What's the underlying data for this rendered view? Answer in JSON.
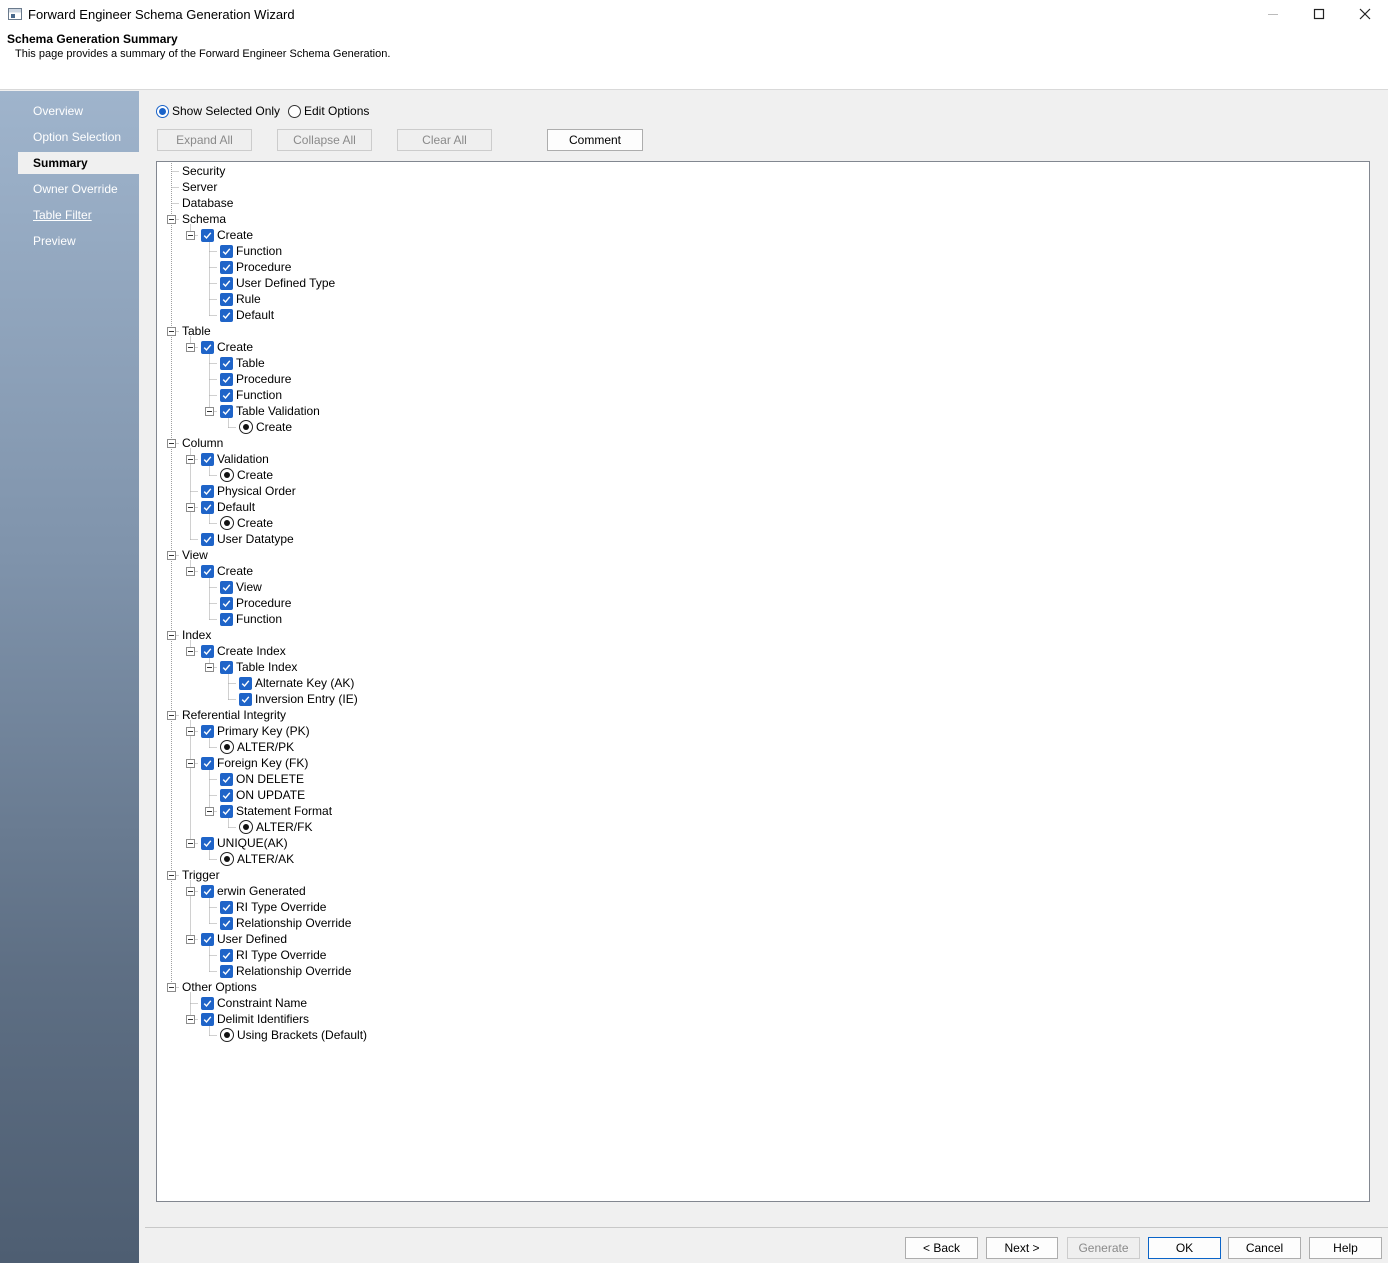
{
  "window": {
    "title": "Forward Engineer Schema Generation Wizard",
    "controls": [
      "minimize-icon",
      "maximize-icon",
      "close-icon"
    ]
  },
  "header": {
    "title": "Schema Generation Summary",
    "subtitle": "This page provides a summary of the Forward Engineer Schema Generation."
  },
  "sidebar": {
    "items": [
      {
        "label": "Overview",
        "state": "normal"
      },
      {
        "label": "Option Selection",
        "state": "normal"
      },
      {
        "label": "Summary",
        "state": "active"
      },
      {
        "label": "Owner Override",
        "state": "normal"
      },
      {
        "label": "Table Filter",
        "state": "link"
      },
      {
        "label": "Preview",
        "state": "normal"
      }
    ]
  },
  "view_mode": {
    "show_selected_only": "Show Selected Only",
    "edit_options": "Edit Options",
    "selected": "show_selected_only"
  },
  "toolbar": {
    "expand_all": "Expand All",
    "collapse_all": "Collapse All",
    "clear_all": "Clear All",
    "comment": "Comment"
  },
  "tree": [
    {
      "label": "Security",
      "level": 0,
      "control": "none"
    },
    {
      "label": "Server",
      "level": 0,
      "control": "none"
    },
    {
      "label": "Database",
      "level": 0,
      "control": "none"
    },
    {
      "label": "Schema",
      "level": 0,
      "control": "none",
      "expanded": true
    },
    {
      "label": "Create",
      "level": 1,
      "control": "checkbox",
      "expanded": true
    },
    {
      "label": "Function",
      "level": 2,
      "control": "checkbox"
    },
    {
      "label": "Procedure",
      "level": 2,
      "control": "checkbox"
    },
    {
      "label": "User Defined Type",
      "level": 2,
      "control": "checkbox"
    },
    {
      "label": "Rule",
      "level": 2,
      "control": "checkbox"
    },
    {
      "label": "Default",
      "level": 2,
      "control": "checkbox"
    },
    {
      "label": "Table",
      "level": 0,
      "control": "none",
      "expanded": true
    },
    {
      "label": "Create",
      "level": 1,
      "control": "checkbox",
      "expanded": true
    },
    {
      "label": "Table",
      "level": 2,
      "control": "checkbox"
    },
    {
      "label": "Procedure",
      "level": 2,
      "control": "checkbox"
    },
    {
      "label": "Function",
      "level": 2,
      "control": "checkbox"
    },
    {
      "label": "Table Validation",
      "level": 2,
      "control": "checkbox",
      "expanded": true
    },
    {
      "label": "Create",
      "level": 3,
      "control": "radio"
    },
    {
      "label": "Column",
      "level": 0,
      "control": "none",
      "expanded": true
    },
    {
      "label": "Validation",
      "level": 1,
      "control": "checkbox",
      "expanded": true
    },
    {
      "label": "Create",
      "level": 2,
      "control": "radio"
    },
    {
      "label": "Physical Order",
      "level": 1,
      "control": "checkbox"
    },
    {
      "label": "Default",
      "level": 1,
      "control": "checkbox",
      "expanded": true
    },
    {
      "label": "Create",
      "level": 2,
      "control": "radio"
    },
    {
      "label": "User Datatype",
      "level": 1,
      "control": "checkbox"
    },
    {
      "label": "View",
      "level": 0,
      "control": "none",
      "expanded": true
    },
    {
      "label": "Create",
      "level": 1,
      "control": "checkbox",
      "expanded": true
    },
    {
      "label": "View",
      "level": 2,
      "control": "checkbox"
    },
    {
      "label": "Procedure",
      "level": 2,
      "control": "checkbox"
    },
    {
      "label": "Function",
      "level": 2,
      "control": "checkbox"
    },
    {
      "label": "Index",
      "level": 0,
      "control": "none",
      "expanded": true
    },
    {
      "label": "Create Index",
      "level": 1,
      "control": "checkbox",
      "expanded": true
    },
    {
      "label": "Table Index",
      "level": 2,
      "control": "checkbox",
      "expanded": true
    },
    {
      "label": "Alternate Key (AK)",
      "level": 3,
      "control": "checkbox"
    },
    {
      "label": "Inversion Entry (IE)",
      "level": 3,
      "control": "checkbox"
    },
    {
      "label": "Referential Integrity",
      "level": 0,
      "control": "none",
      "expanded": true
    },
    {
      "label": "Primary Key (PK)",
      "level": 1,
      "control": "checkbox",
      "expanded": true
    },
    {
      "label": "ALTER/PK",
      "level": 2,
      "control": "radio"
    },
    {
      "label": "Foreign Key (FK)",
      "level": 1,
      "control": "checkbox",
      "expanded": true
    },
    {
      "label": "ON DELETE",
      "level": 2,
      "control": "checkbox"
    },
    {
      "label": "ON UPDATE",
      "level": 2,
      "control": "checkbox"
    },
    {
      "label": "Statement Format",
      "level": 2,
      "control": "checkbox",
      "expanded": true
    },
    {
      "label": "ALTER/FK",
      "level": 3,
      "control": "radio"
    },
    {
      "label": "UNIQUE(AK)",
      "level": 1,
      "control": "checkbox",
      "expanded": true
    },
    {
      "label": "ALTER/AK",
      "level": 2,
      "control": "radio"
    },
    {
      "label": "Trigger",
      "level": 0,
      "control": "none",
      "expanded": true
    },
    {
      "label": "erwin Generated",
      "level": 1,
      "control": "checkbox",
      "expanded": true
    },
    {
      "label": "RI Type Override",
      "level": 2,
      "control": "checkbox"
    },
    {
      "label": "Relationship Override",
      "level": 2,
      "control": "checkbox"
    },
    {
      "label": "User Defined",
      "level": 1,
      "control": "checkbox",
      "expanded": true
    },
    {
      "label": "RI Type Override",
      "level": 2,
      "control": "checkbox"
    },
    {
      "label": "Relationship Override",
      "level": 2,
      "control": "checkbox"
    },
    {
      "label": "Other Options",
      "level": 0,
      "control": "none",
      "expanded": true
    },
    {
      "label": "Constraint Name",
      "level": 1,
      "control": "checkbox"
    },
    {
      "label": "Delimit Identifiers",
      "level": 1,
      "control": "checkbox",
      "expanded": true
    },
    {
      "label": "Using Brackets (Default)",
      "level": 2,
      "control": "radio"
    }
  ],
  "footer": {
    "back": "< Back",
    "next": "Next >",
    "generate": "Generate",
    "ok": "OK",
    "cancel": "Cancel",
    "help": "Help"
  },
  "colors": {
    "accent": "#1f64c8",
    "sidebar_top": "#9fb4cc",
    "sidebar_bottom": "#4e5e72"
  }
}
